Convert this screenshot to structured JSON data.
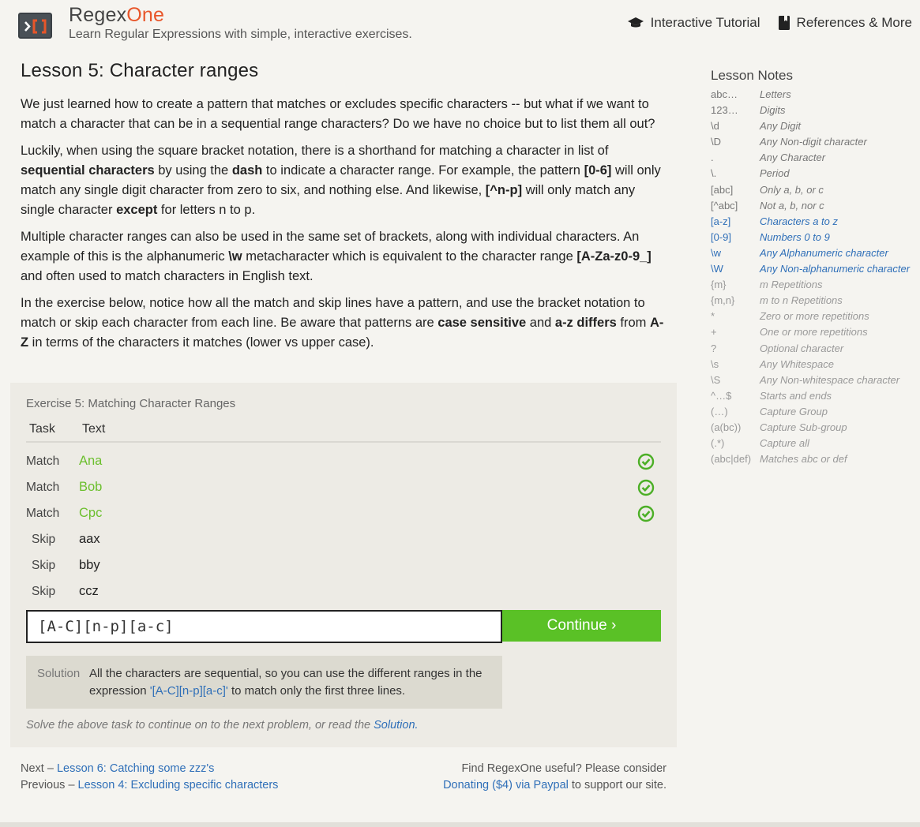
{
  "header": {
    "brand_main": "Regex",
    "brand_accent": "One",
    "tagline": "Learn Regular Expressions with simple, interactive exercises.",
    "nav": [
      {
        "label": "Interactive Tutorial",
        "icon": "graduation-cap-icon"
      },
      {
        "label": "References & More",
        "icon": "book-icon"
      }
    ]
  },
  "lesson": {
    "title": "Lesson 5: Character ranges",
    "p1": "We just learned how to create a pattern that matches or excludes specific characters -- but what if we want to match a character that can be in a sequential range characters? Do we have no choice but to list them all out?",
    "p2": {
      "t1": "Luckily, when using the square bracket notation, there is a shorthand for matching a character in list of ",
      "b1": "sequential characters",
      "t2": " by using the ",
      "b2": "dash",
      "t3": " to indicate a character range. For example, the pattern ",
      "b3": "[0-6]",
      "t4": " will only match any single digit character from zero to six, and nothing else. And likewise, ",
      "b4": "[^n-p]",
      "t5": " will only match any single character ",
      "b5": "except",
      "t6": " for letters n to p."
    },
    "p3": {
      "t1": "Multiple character ranges can also be used in the same set of brackets, along with individual characters. An example of this is the alphanumeric ",
      "b1": "\\w",
      "t2": " metacharacter which is equivalent to the character range ",
      "b2": "[A-Za-z0-9_]",
      "t3": " and often used to match characters in English text."
    },
    "p4": {
      "t1": "In the exercise below, notice how all the match and skip lines have a pattern, and use the bracket notation to match or skip each character from each line. Be aware that patterns are ",
      "b1": "case sensitive",
      "t2": " and ",
      "b2": "a-z differs",
      "t3": " from ",
      "b3": "A-Z",
      "t4": " in terms of the characters it matches (lower vs upper case)."
    }
  },
  "exercise": {
    "title": "Exercise 5: Matching Character Ranges",
    "col_task": "Task",
    "col_text": "Text",
    "rows": [
      {
        "task": "Match",
        "text": "Ana"
      },
      {
        "task": "Match",
        "text": "Bob"
      },
      {
        "task": "Match",
        "text": "Cpc"
      },
      {
        "task": "Skip",
        "text": "aax"
      },
      {
        "task": "Skip",
        "text": "bby"
      },
      {
        "task": "Skip",
        "text": "ccz"
      }
    ],
    "input_value": "[A-C][n-p][a-c]",
    "continue_label": "Continue ›",
    "solution_label": "Solution",
    "solution_t1": "All the characters are sequential, so you can use the different ranges in the expression ",
    "solution_expr": "'[A-C][n-p][a-c]'",
    "solution_t2": " to match only the first three lines.",
    "footer_text": "Solve the above task to continue on to the next problem, or read the ",
    "footer_link": "Solution."
  },
  "footer": {
    "next_prefix": "Next – ",
    "next_link": "Lesson 6: Catching some zzz's",
    "prev_prefix": "Previous – ",
    "prev_link": "Lesson 4: Excluding specific characters",
    "right_line1": "Find RegexOne useful? Please consider",
    "donate_link": "Donating ($4) via Paypal",
    "right_suffix": " to support our site."
  },
  "sidebar": {
    "title": "Lesson Notes",
    "notes": [
      {
        "k": "abc…",
        "v": "Letters"
      },
      {
        "k": "123…",
        "v": "Digits"
      },
      {
        "k": "\\d",
        "v": "Any Digit"
      },
      {
        "k": "\\D",
        "v": "Any Non-digit character"
      },
      {
        "k": ".",
        "v": "Any Character"
      },
      {
        "k": "\\.",
        "v": "Period"
      },
      {
        "k": "[abc]",
        "v": "Only a, b, or c"
      },
      {
        "k": "[^abc]",
        "v": "Not a, b, nor c"
      },
      {
        "k": "[a-z]",
        "v": "Characters a to z"
      },
      {
        "k": "[0-9]",
        "v": "Numbers 0 to 9"
      },
      {
        "k": "\\w",
        "v": "Any Alphanumeric character"
      },
      {
        "k": "\\W",
        "v": "Any Non-alphanumeric character"
      },
      {
        "k": "{m}",
        "v": "m Repetitions"
      },
      {
        "k": "{m,n}",
        "v": "m to n Repetitions"
      },
      {
        "k": "*",
        "v": "Zero or more repetitions"
      },
      {
        "k": "+",
        "v": "One or more repetitions"
      },
      {
        "k": "?",
        "v": "Optional character"
      },
      {
        "k": "\\s",
        "v": "Any Whitespace"
      },
      {
        "k": "\\S",
        "v": "Any Non-whitespace character"
      },
      {
        "k": "^…$",
        "v": "Starts and ends"
      },
      {
        "k": "(…)",
        "v": "Capture Group"
      },
      {
        "k": "(a(bc))",
        "v": "Capture Sub-group"
      },
      {
        "k": "(.*)",
        "v": "Capture all"
      },
      {
        "k": "(abc|def)",
        "v": "Matches abc or def"
      }
    ]
  },
  "colors": {
    "accent": "#e8562a",
    "link": "#2f6fb8",
    "success": "#5ac126"
  }
}
